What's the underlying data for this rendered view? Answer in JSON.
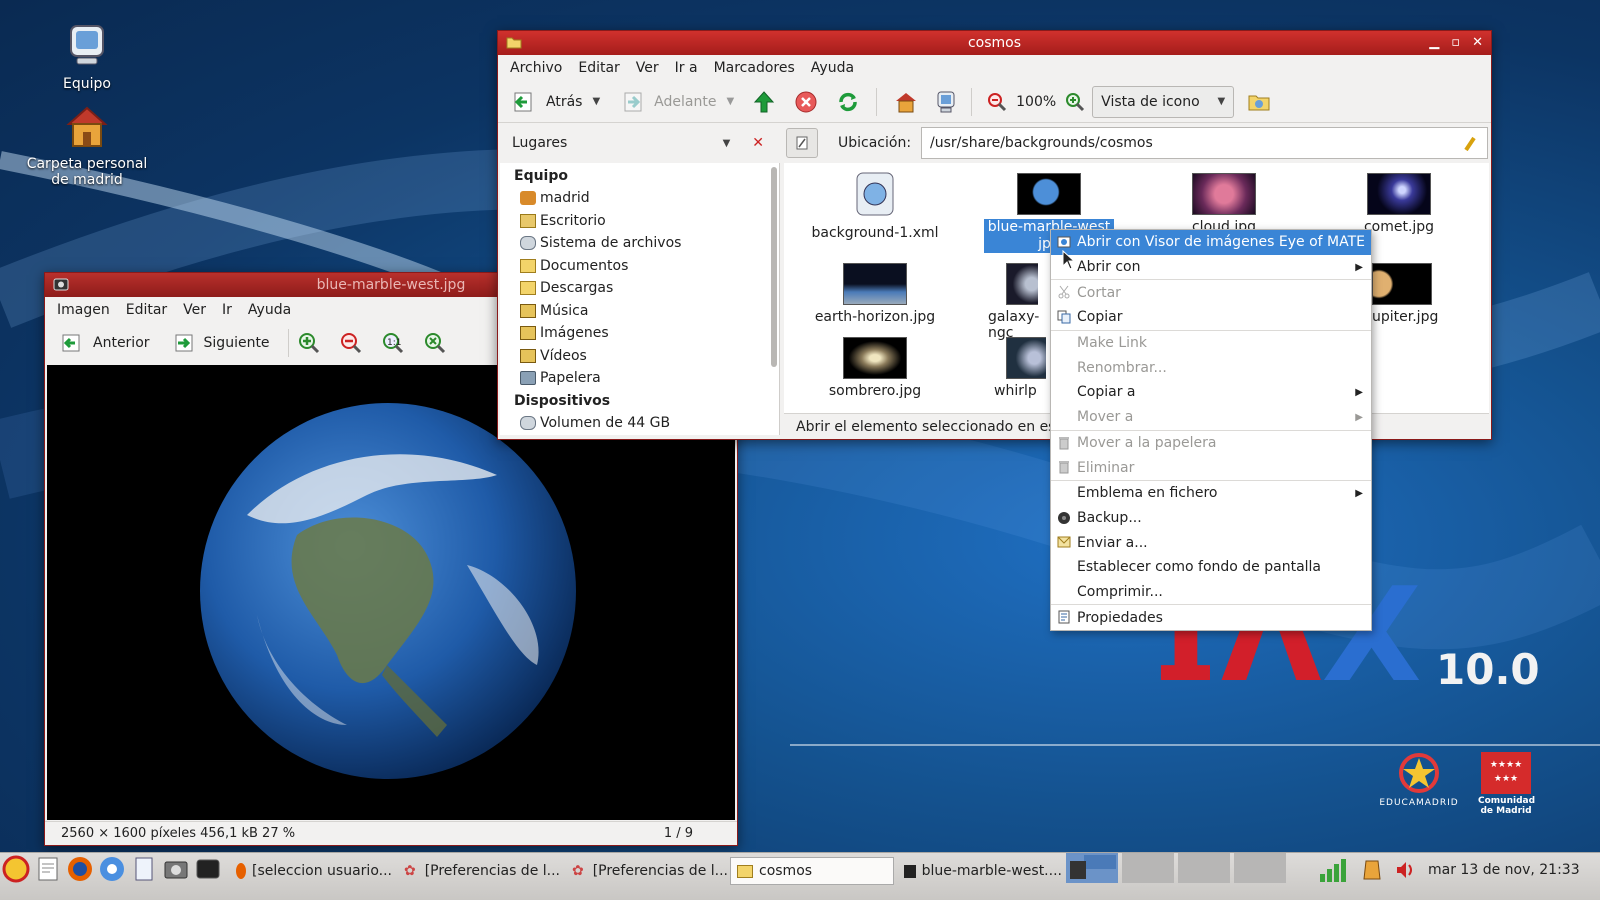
{
  "desktop": {
    "icons": [
      {
        "label": "Equipo",
        "icon": "computer-icon"
      },
      {
        "label": "Carpeta personal de madrid",
        "icon": "home-folder-icon"
      }
    ],
    "branding": {
      "version": "10.0",
      "educa": "EDUCAMADRID",
      "comunidad": "Comunidad de Madrid"
    }
  },
  "viewer": {
    "title": "blue-marble-west.jpg",
    "menu": [
      "Imagen",
      "Editar",
      "Ver",
      "Ir",
      "Ayuda"
    ],
    "prev_label": "Anterior",
    "next_label": "Siguiente",
    "status_dims": "2560 × 1600 píxeles  456,1 kB   27 %",
    "status_pos": "1 / 9"
  },
  "caja": {
    "title": "cosmos",
    "menu": [
      "Archivo",
      "Editar",
      "Ver",
      "Ir a",
      "Marcadores",
      "Ayuda"
    ],
    "back_label": "Atrás",
    "forward_label": "Adelante",
    "zoom": "100%",
    "view_mode": "Vista de icono",
    "places_label": "Lugares",
    "location_label": "Ubicación:",
    "location_path": "/usr/share/backgrounds/cosmos",
    "sidebar": {
      "computer_heading": "Equipo",
      "computer_items": [
        "madrid",
        "Escritorio",
        "Sistema de archivos",
        "Documentos",
        "Descargas",
        "Música",
        "Imágenes",
        "Vídeos",
        "Papelera"
      ],
      "devices_heading": "Dispositivos",
      "device_items": [
        "Volumen de 44 GB"
      ]
    },
    "files": [
      {
        "name": "background-1.xml"
      },
      {
        "name": "blue-marble-west.jpg",
        "line1": "blue-marble-west",
        "line2": "jpg"
      },
      {
        "name": "cloud.jpg"
      },
      {
        "name": "comet.jpg"
      },
      {
        "name": "earth-horizon.jpg"
      },
      {
        "name": "galaxy-ngc"
      },
      {
        "name": "jupiter.jpg",
        "shown": "upiter.jpg"
      },
      {
        "name": "sombrero.jpg"
      },
      {
        "name": "whirlp"
      }
    ],
    "statusbar": "Abrir el elemento seleccionado en esta"
  },
  "context_menu": {
    "items": [
      {
        "label": "Abrir con Visor de imágenes Eye of MATE",
        "state": "selected",
        "icon": "eye-of-mate-icon"
      },
      {
        "label": "Abrir con",
        "submenu": true
      },
      {
        "label": "Cortar",
        "state": "disabled",
        "icon": "scissors-icon"
      },
      {
        "label": "Copiar",
        "icon": "copy-icon"
      },
      {
        "label": "Make Link",
        "state": "disabled"
      },
      {
        "label": "Renombrar...",
        "state": "disabled"
      },
      {
        "label": "Copiar a",
        "submenu": true
      },
      {
        "label": "Mover a",
        "state": "disabled",
        "submenu": true
      },
      {
        "label": "Mover a la papelera",
        "state": "disabled",
        "icon": "trash-icon"
      },
      {
        "label": "Eliminar",
        "state": "disabled",
        "icon": "delete-icon"
      },
      {
        "label": "Emblema en fichero",
        "submenu": true
      },
      {
        "label": "Backup...",
        "icon": "backup-icon"
      },
      {
        "label": "Enviar a...",
        "icon": "send-icon"
      },
      {
        "label": "Establecer como fondo de pantalla"
      },
      {
        "label": "Comprimir..."
      },
      {
        "label": "Propiedades",
        "icon": "properties-icon"
      }
    ]
  },
  "taskbar": {
    "tasks": [
      {
        "label": "[seleccion usuario..."
      },
      {
        "label": "[Preferencias de l..."
      },
      {
        "label": "[Preferencias de l..."
      },
      {
        "label": "cosmos"
      },
      {
        "label": "blue-marble-west...."
      }
    ],
    "clock": "mar 13 de nov, 21:33"
  },
  "colors": {
    "accent": "#3a85d6",
    "titlebar": "#c4282a",
    "desktop": "#14528f"
  }
}
